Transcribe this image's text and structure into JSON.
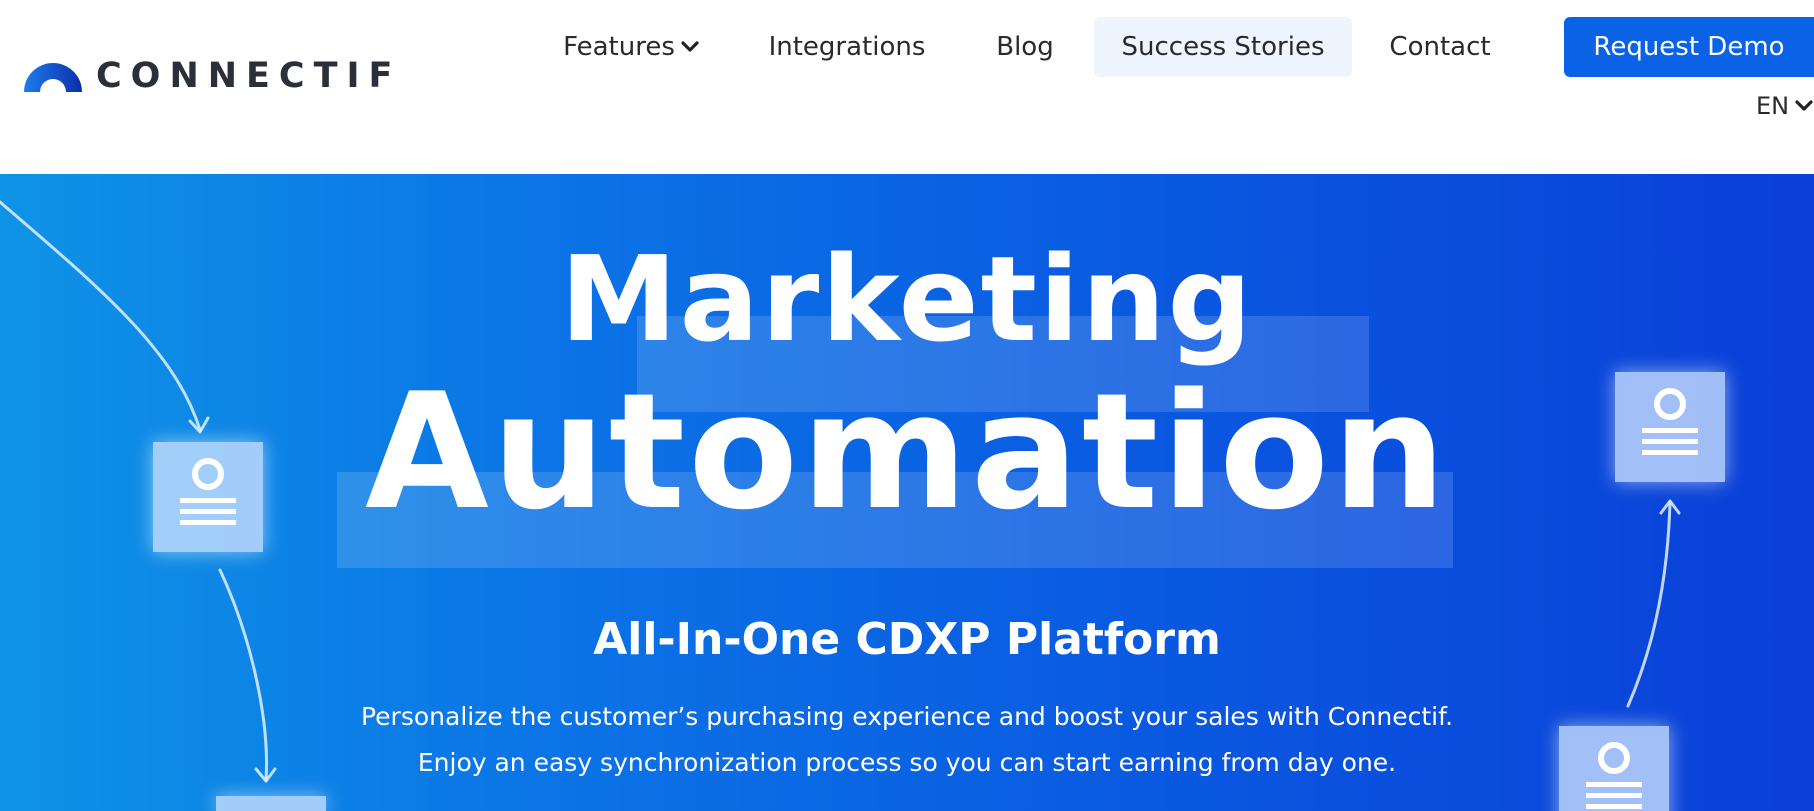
{
  "brand": {
    "name": "CONNECTIF"
  },
  "nav": {
    "items": [
      {
        "label": "Features"
      },
      {
        "label": "Integrations"
      },
      {
        "label": "Blog"
      },
      {
        "label": "Success Stories"
      },
      {
        "label": "Contact"
      }
    ],
    "cta_label": "Request Demo",
    "language": "EN"
  },
  "hero": {
    "title_line1": "Marketing",
    "title_line2": "Automation",
    "subtitle": "All-In-One CDXP Platform",
    "description_line1": "Personalize the customer’s purchasing experience and boost your sales with Connectif.",
    "description_line2": "Enjoy an easy synchronization process so you can start earning from day one."
  },
  "icons": {
    "logo": "connectif-logo-arc-icon",
    "dropdown": "chevron-down-icon",
    "card": "profile-card-icon",
    "flow_arrow": "flow-arrow-icon"
  },
  "colors": {
    "brand_blue": "#0a63e6",
    "hero_gradient_start": "#0e93e6",
    "hero_gradient_end": "#0a3fd8",
    "active_nav_bg": "#eef5ff",
    "text_dark": "#2a2a2a"
  }
}
